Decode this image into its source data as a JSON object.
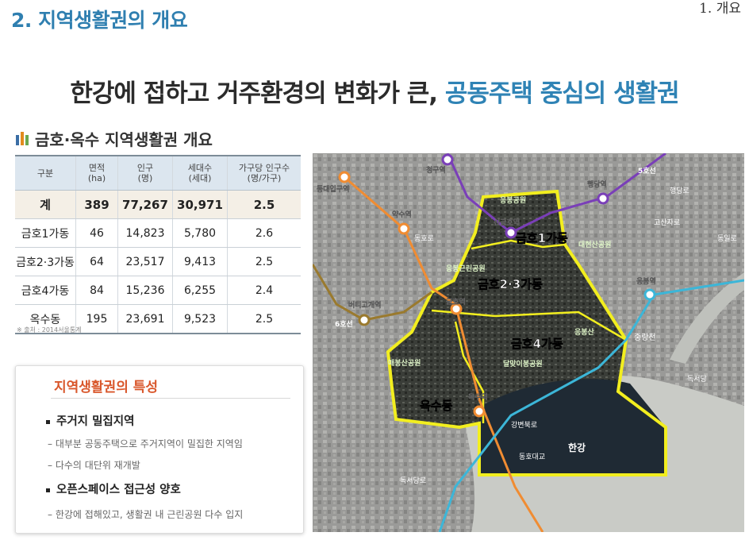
{
  "header": {
    "section_title": "2. 지역생활권의 개요",
    "chapter": "1. 개요"
  },
  "headline": {
    "part1": "한강에 접하고 거주환경의 변화가 큰, ",
    "part2": "공동주택 중심의 생활권"
  },
  "table_title": "금호·옥수 지역생활권 개요",
  "table": {
    "headers": [
      "구분",
      "면적\n(ha)",
      "인구\n(명)",
      "세대수\n(세대)",
      "가구당 인구수\n(명/가구)"
    ],
    "rows": [
      [
        "계",
        "389",
        "77,267",
        "30,971",
        "2.5"
      ],
      [
        "금호1가동",
        "46",
        "14,823",
        "5,780",
        "2.6"
      ],
      [
        "금호2·3가동",
        "64",
        "23,517",
        "9,413",
        "2.5"
      ],
      [
        "금호4가동",
        "84",
        "15,236",
        "6,255",
        "2.4"
      ],
      [
        "옥수동",
        "195",
        "23,691",
        "9,523",
        "2.5"
      ]
    ]
  },
  "source": "※ 출처 : 2014서울통계",
  "characteristics": {
    "title": "지역생활권의 특성",
    "item1": "주거지 밀집지역",
    "item1_sub1": "–  대부분 공동주택으로 주거지역이 밀집한 지역임",
    "item1_sub2": "–  다수의 대단위 재개발",
    "item2": "오픈스페이스 접근성 양호",
    "item2_sub1": "–  한강에 접해있고, 생활권 내 근린공원 다수 입지"
  },
  "map": {
    "stations": [
      "청구역",
      "행당역",
      "동대입구역",
      "약수역",
      "신금호역",
      "버티고개역",
      "응봉역",
      "금호역",
      "옥수역"
    ],
    "dongs": [
      "금호1가동",
      "금호2·3가동",
      "금호4가동",
      "옥수동"
    ],
    "parks": [
      "응봉공원",
      "대현산공원",
      "응봉근린공원",
      "응봉산",
      "달맞이봉공원",
      "매봉산공원"
    ],
    "lines": [
      "5호선",
      "6호선"
    ],
    "roads": [
      "동호로",
      "독서당로",
      "강변북로",
      "동호대교",
      "고산자로",
      "행당로",
      "독서당",
      "동일로"
    ],
    "streams": [
      "중랑천"
    ],
    "river": "한강"
  },
  "colors": {
    "accent_blue": "#2f7fb0",
    "accent_orange": "#d9572b",
    "table_header": "#dce6ef",
    "total_row": "#f4efe6",
    "boundary": "#f2ee1f",
    "line5": "#7a3fb8",
    "line3": "#f08c32",
    "line_gyeongui": "#3cb6d8",
    "line6": "#9a7a2e"
  }
}
